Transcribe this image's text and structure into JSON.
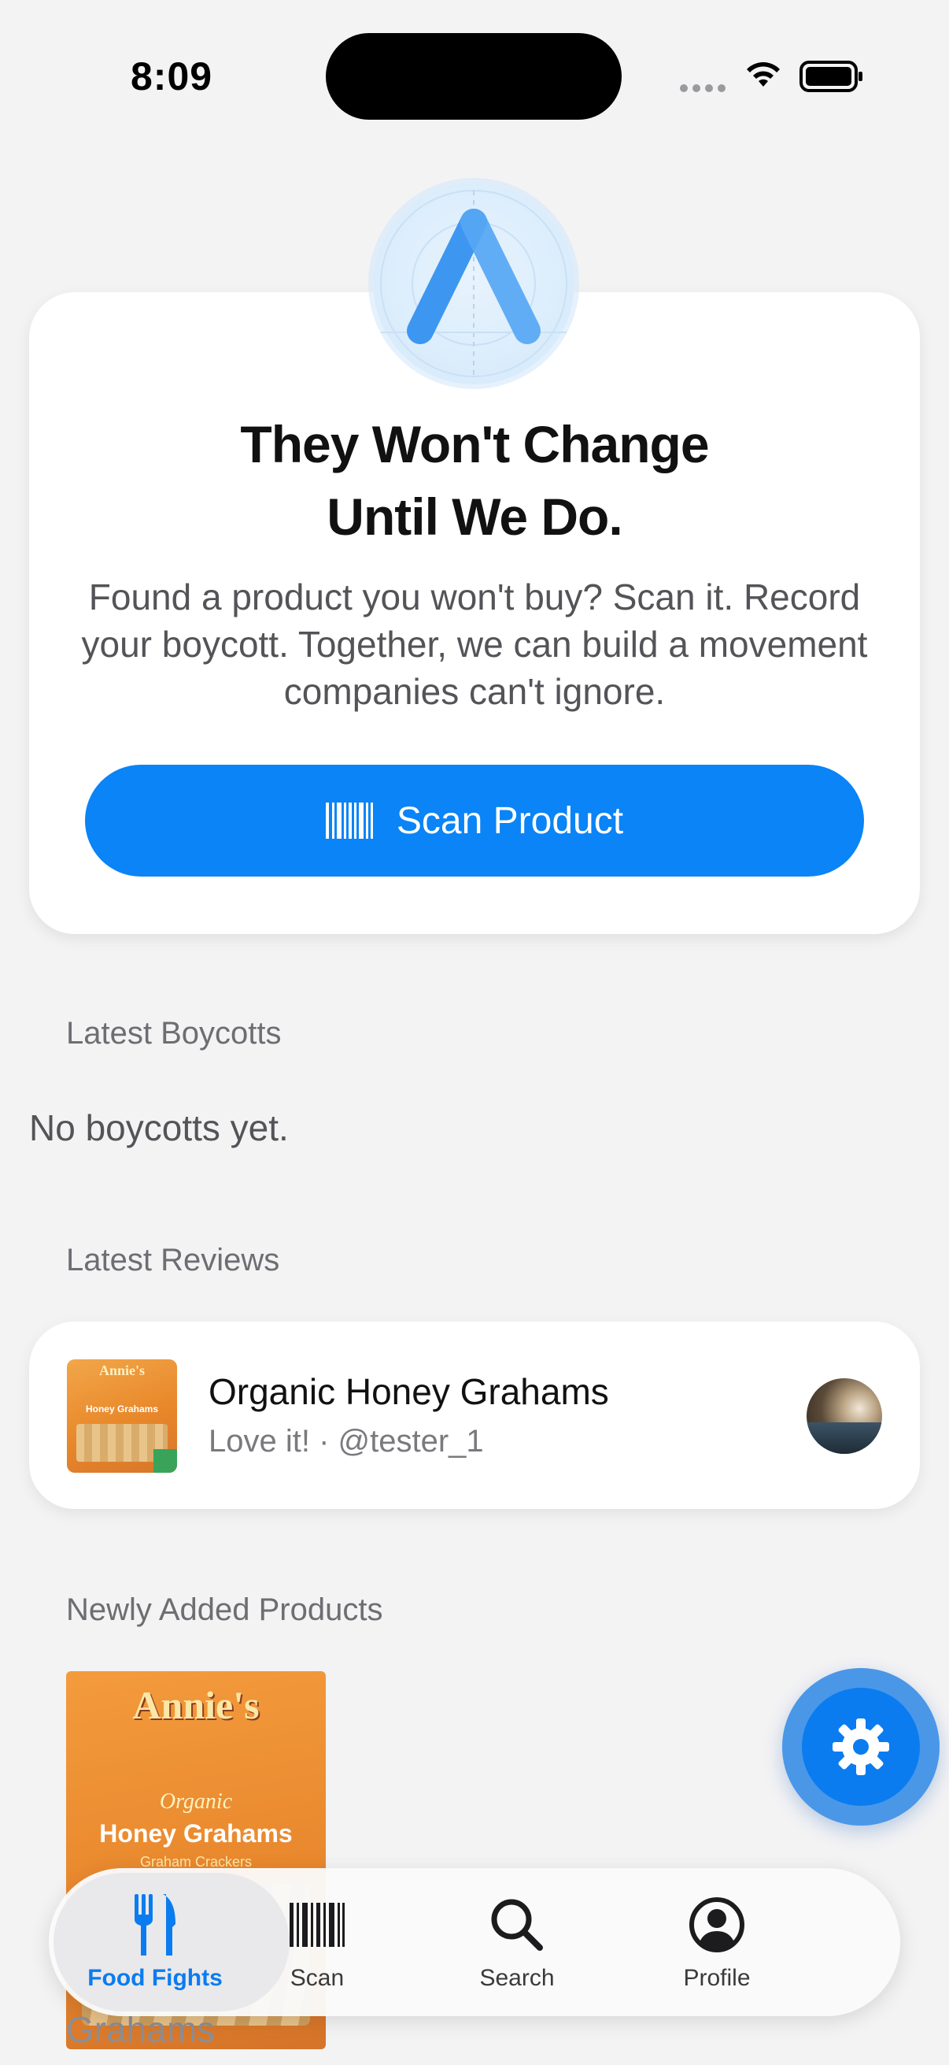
{
  "status_bar": {
    "time": "8:09"
  },
  "hero": {
    "title_line1": "They Won't Change",
    "title_line2": "Until We Do.",
    "description": "Found a product you won't buy? Scan it. Record your boycott. Together, we can build a movement companies can't ignore.",
    "scan_button_label": "Scan Product"
  },
  "sections": {
    "boycotts_label": "Latest Boycotts",
    "boycotts_empty": "No boycotts yet.",
    "reviews_label": "Latest Reviews",
    "products_label": "Newly Added Products"
  },
  "review": {
    "product_name": "Organic Honey Grahams",
    "subtitle": "Love it! · @tester_1"
  },
  "product": {
    "caption": "Grahams"
  },
  "tab_bar": {
    "tabs": [
      {
        "label": "Food Fights",
        "icon": "fork-knife-icon",
        "active": true
      },
      {
        "label": "Scan",
        "icon": "barcode-icon",
        "active": false
      },
      {
        "label": "Search",
        "icon": "magnifier-icon",
        "active": false
      },
      {
        "label": "Profile",
        "icon": "person-circle-icon",
        "active": false
      }
    ]
  },
  "colors": {
    "accent": "#0a84f6",
    "background": "#f3f3f4",
    "card": "#ffffff"
  }
}
